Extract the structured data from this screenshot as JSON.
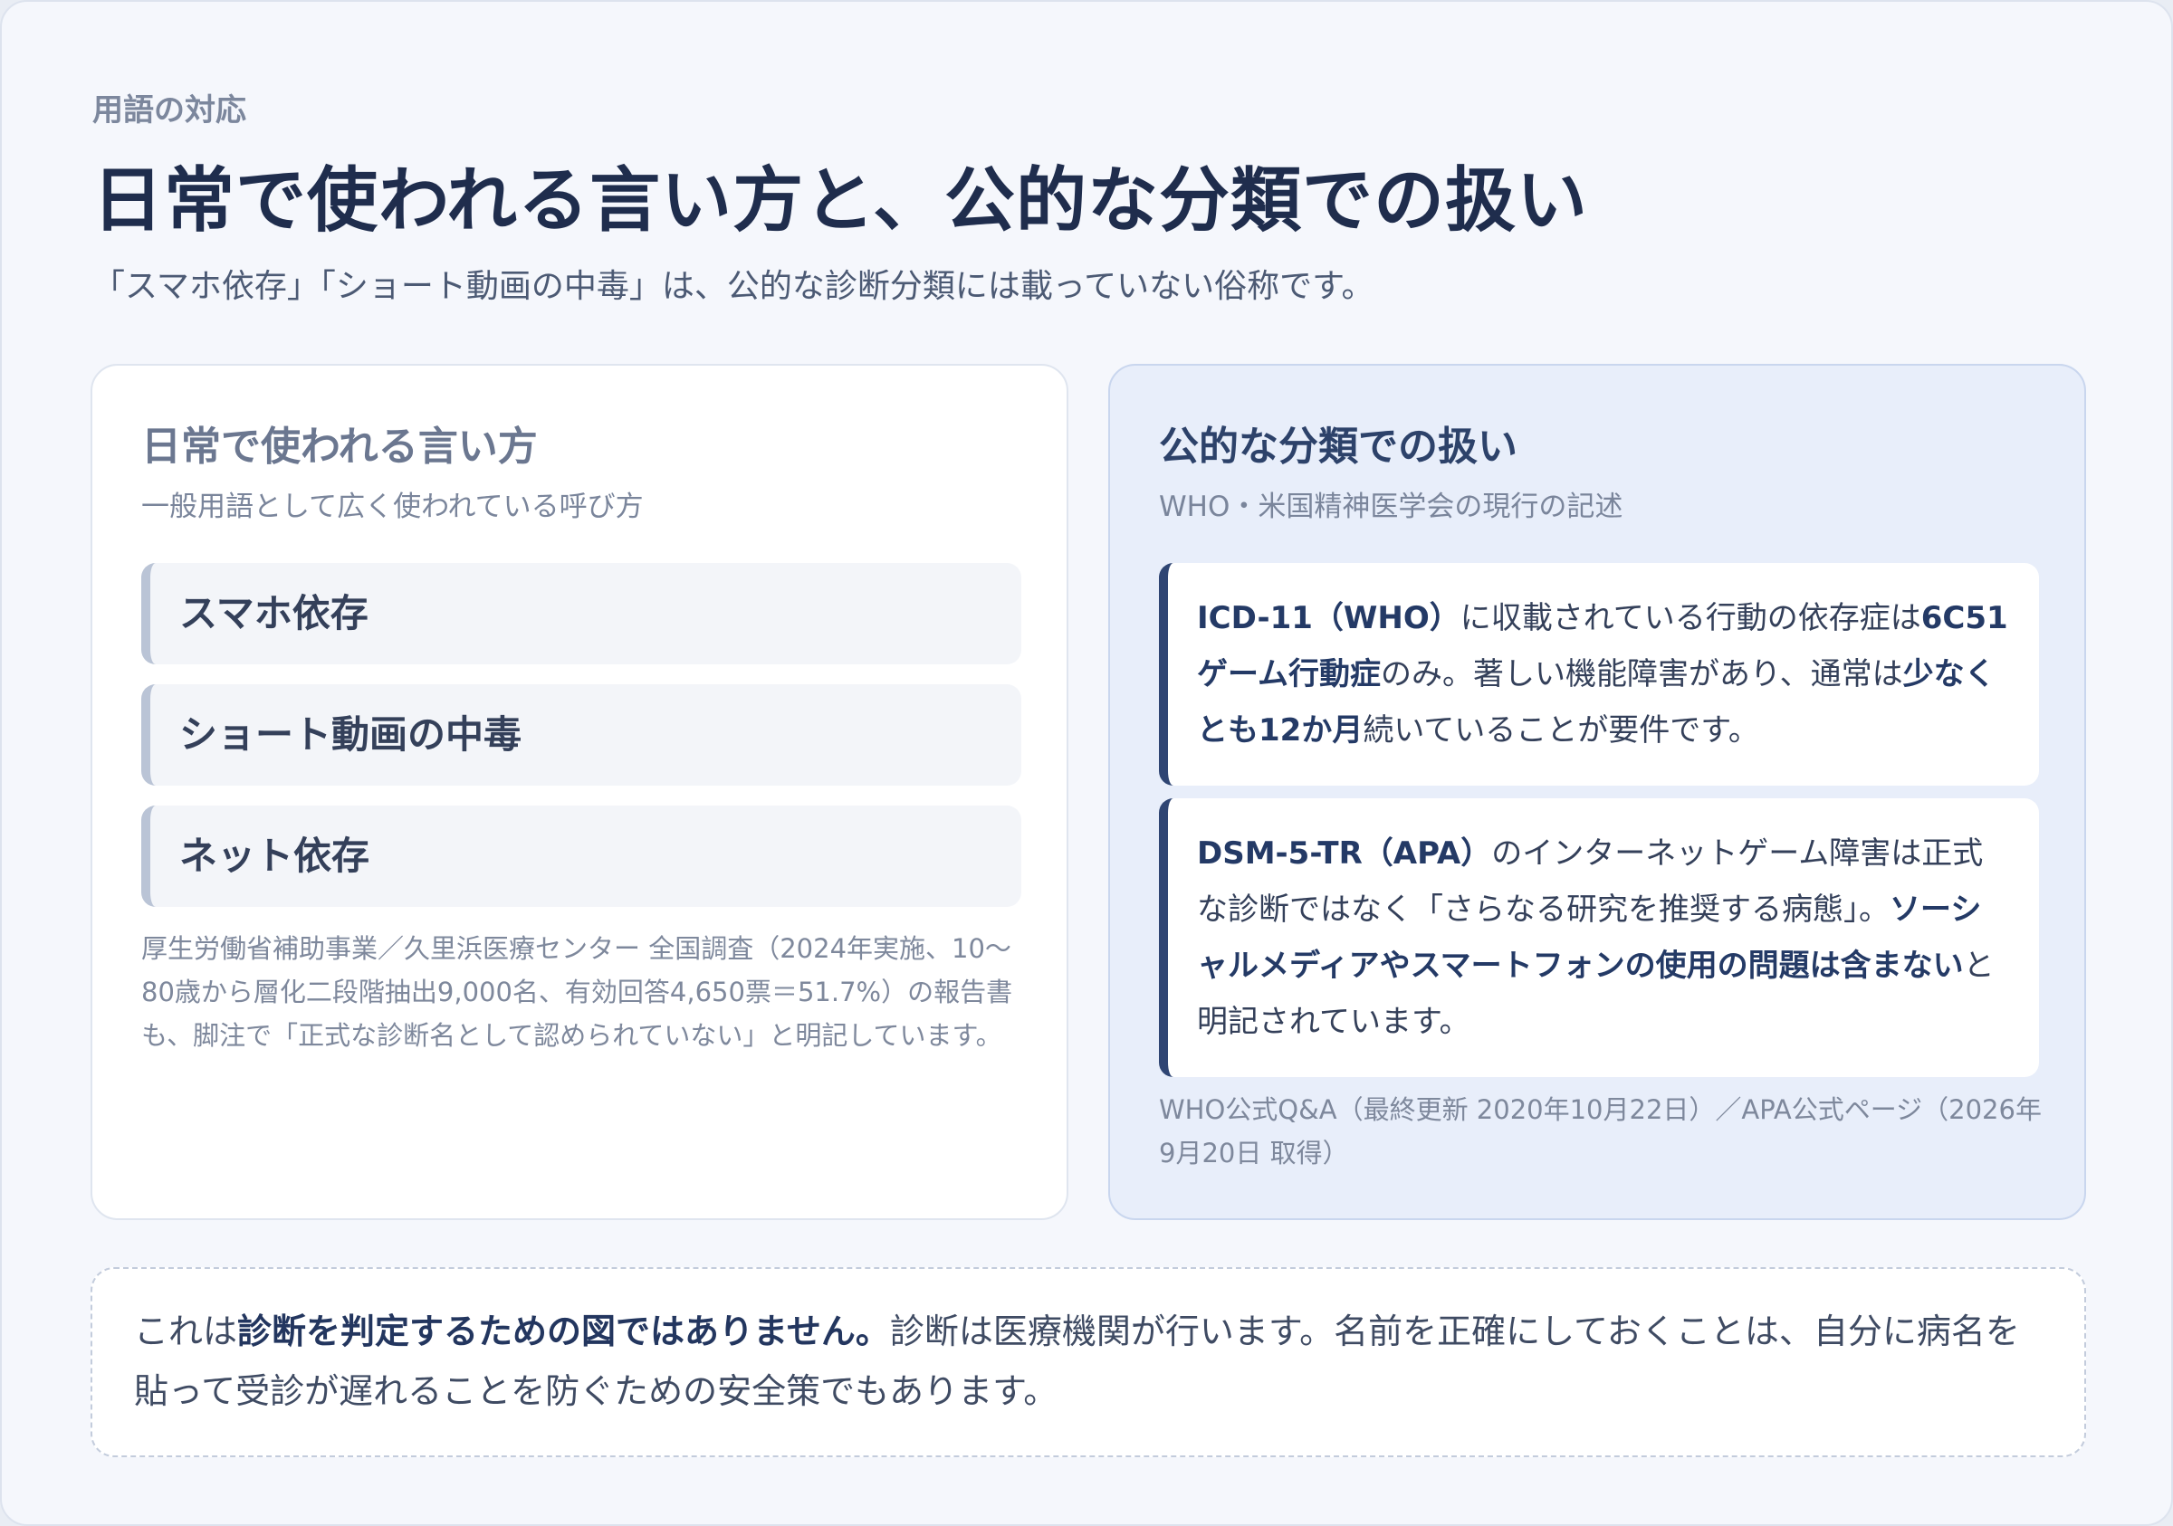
{
  "header": {
    "eyebrow": "用語の対応",
    "title": "日常で使われる言い方と、公的な分類での扱い",
    "subtitle": "「スマホ依存」「ショート動画の中毒」は、公的な診断分類には載っていない俗称です。"
  },
  "left": {
    "title": "日常で使われる言い方",
    "subtitle": "一般用語として広く使われている呼び方",
    "terms": [
      "スマホ依存",
      "ショート動画の中毒",
      "ネット依存"
    ],
    "note": "厚生労働省補助事業／久里浜医療センター 全国調査（2024年実施、10〜80歳から層化二段階抽出9,000名、有効回答4,650票＝51.7%）の報告書も、脚注で「正式な診断名として認められていない」と明記しています。"
  },
  "right": {
    "title": "公的な分類での扱い",
    "subtitle": "WHO・米国精神医学会の現行の記述",
    "icd": {
      "b1": "ICD-11（WHO）",
      "t1": "に収載されている行動の依存症は",
      "b2": "6C51 ゲーム行動症",
      "t2": "のみ。著しい機能障害があり、通常は",
      "b3": "少なくとも12か月",
      "t3": "続いていることが要件です。"
    },
    "dsm": {
      "b1": "DSM-5-TR（APA）",
      "t1": "のインターネットゲーム障害は正式な診断ではなく「さらなる研究を推奨する病態」。",
      "b2": "ソーシャルメディアやスマートフォンの使用の問題は含まない",
      "t2": "と明記されています。"
    },
    "note": "WHO公式Q&A（最終更新 2020年10月22日）／APA公式ページ（2026年9月20日 取得）"
  },
  "disclaimer": {
    "t1": "これは",
    "b1": "診断を判定するための図ではありません。",
    "t2": "診断は医療機関が行います。名前を正確にしておくことは、自分に病名を貼って受診が遅れることを防ぐための安全策でもあります。"
  }
}
